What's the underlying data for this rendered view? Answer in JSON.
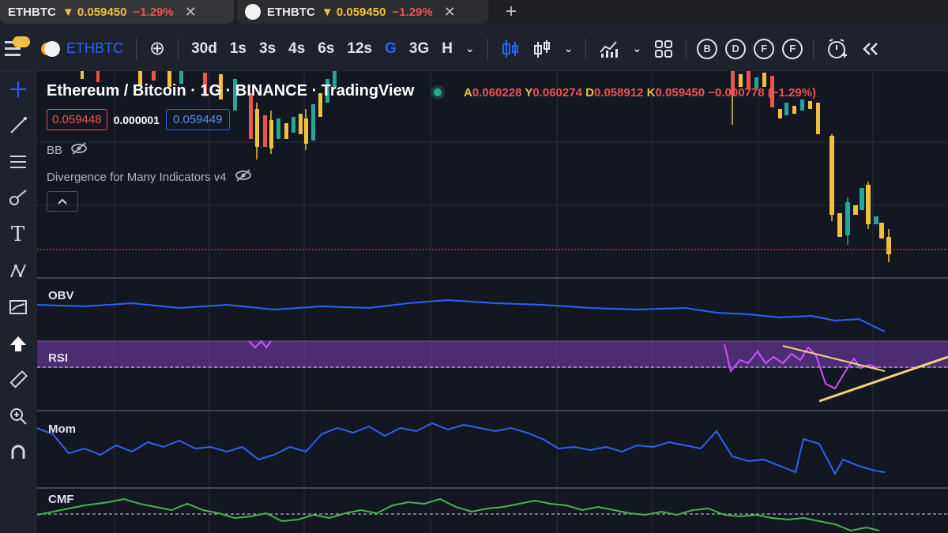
{
  "browser": {
    "tabs": [
      {
        "symbol": "ETHBTC",
        "arrow": "▼",
        "price": "0.059450",
        "change": "−1.29%"
      },
      {
        "symbol": "ETHBTC",
        "arrow": "▼",
        "price": "0.059450",
        "change": "−1.29%"
      }
    ],
    "new_tab": "+"
  },
  "toolbar": {
    "symbol": "ETHBTC",
    "add": "⊕",
    "intervals": [
      "30d",
      "1s",
      "3s",
      "4s",
      "6s",
      "12s",
      "G",
      "3G",
      "H"
    ],
    "active_interval": "G",
    "circles": [
      "B",
      "D",
      "F",
      "F"
    ]
  },
  "chart": {
    "title": "Ethereum / Bitcoin · 1G · BINANCE · TradingView",
    "ohlc": {
      "open_label": "A",
      "open": "0.060228",
      "high_label": "Y",
      "high": "0.060274",
      "low_label": "D",
      "low": "0.058912",
      "close_label": "K",
      "close": "0.059450",
      "change": "−0.000778 (−1.29%)"
    },
    "sell_price": "0.059448",
    "spread": "0.000001",
    "buy_price": "0.059449",
    "indicators": [
      "BB",
      "Divergence for Many Indicators v4"
    ],
    "colors": {
      "up": "#26a69a",
      "down": "#ef5350",
      "candle_up_glow": "#f0c040",
      "obv": "#2962ff",
      "rsi": "#c050e0",
      "mom": "#3060f0",
      "cmf": "#4caf50"
    }
  },
  "panes": {
    "obv": "OBV",
    "rsi": "RSI",
    "mom": "Mom",
    "cmf": "CMF"
  }
}
